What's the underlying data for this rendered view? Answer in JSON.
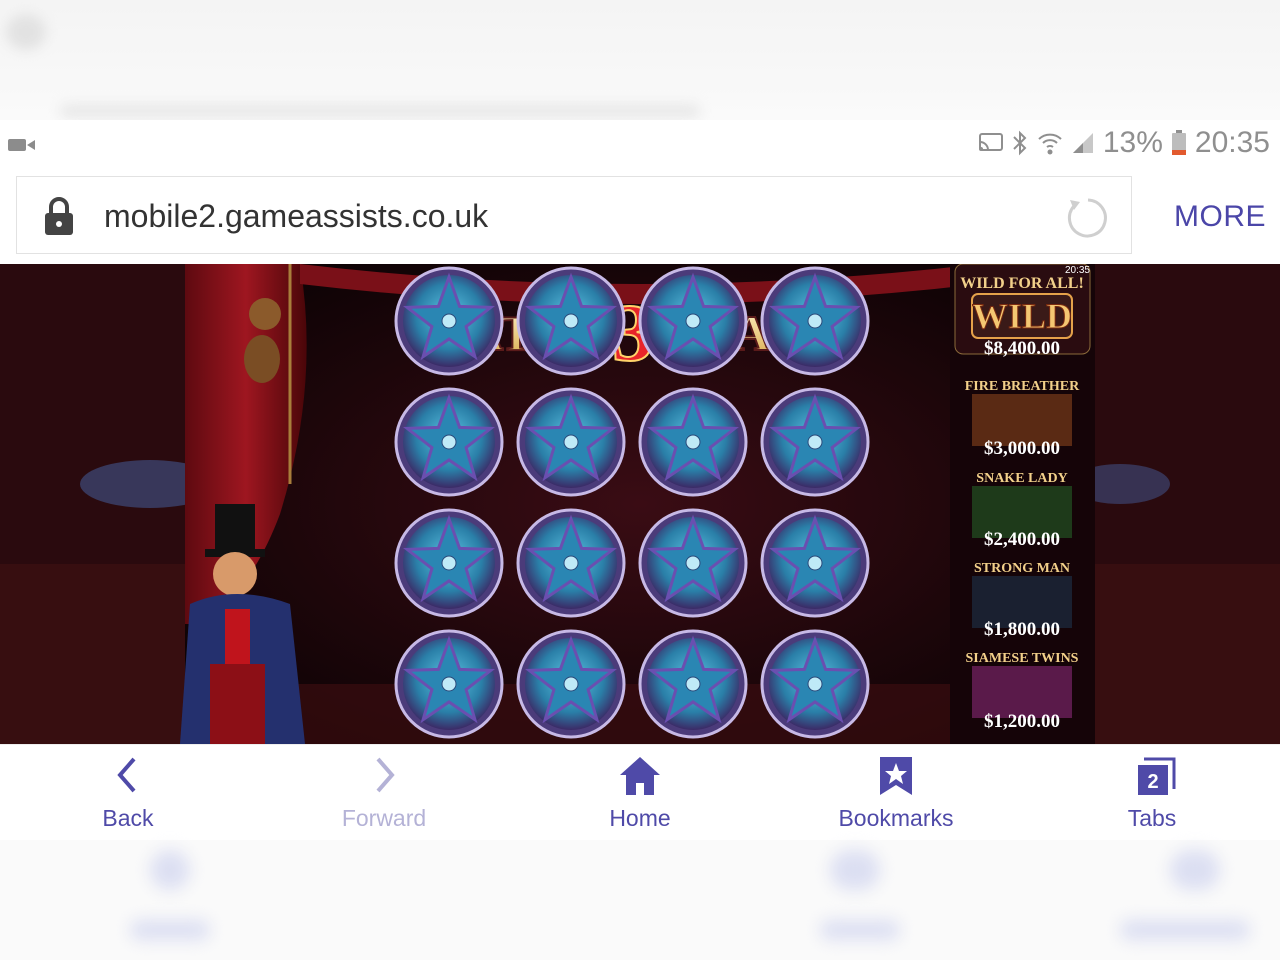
{
  "status_bar": {
    "battery": "13%",
    "time": "20:35",
    "icons": [
      "video-camera-icon",
      "cast-icon",
      "bluetooth-icon",
      "wifi-icon",
      "signal-icon",
      "battery-icon"
    ]
  },
  "browser": {
    "url": "mobile2.gameassists.co.uk",
    "more_label": "MORE",
    "icons": [
      "lock-icon",
      "reload-icon"
    ]
  },
  "game": {
    "title_part1": "MATCH",
    "title_num": "3",
    "title_part2": "STARS",
    "clock": "20:35",
    "wild_header": "WILD FOR ALL!",
    "wild_label": "WILD",
    "paytable": [
      {
        "name": "WILD FOR ALL!",
        "prize": "$8,400.00"
      },
      {
        "name": "FIRE BREATHER",
        "prize": "$3,000.00"
      },
      {
        "name": "SNAKE LADY",
        "prize": "$2,400.00"
      },
      {
        "name": "STRONG MAN",
        "prize": "$1,800.00"
      },
      {
        "name": "SIAMESE TWINS",
        "prize": "$1,200.00"
      }
    ],
    "grid_rows": 4,
    "grid_cols": 4
  },
  "nav": {
    "back": "Back",
    "forward": "Forward",
    "home": "Home",
    "bookmarks": "Bookmarks",
    "tabs": "Tabs",
    "tabs_count": "2"
  },
  "colors": {
    "accent": "#4f4aa8",
    "disabled": "#b4b2d6"
  }
}
